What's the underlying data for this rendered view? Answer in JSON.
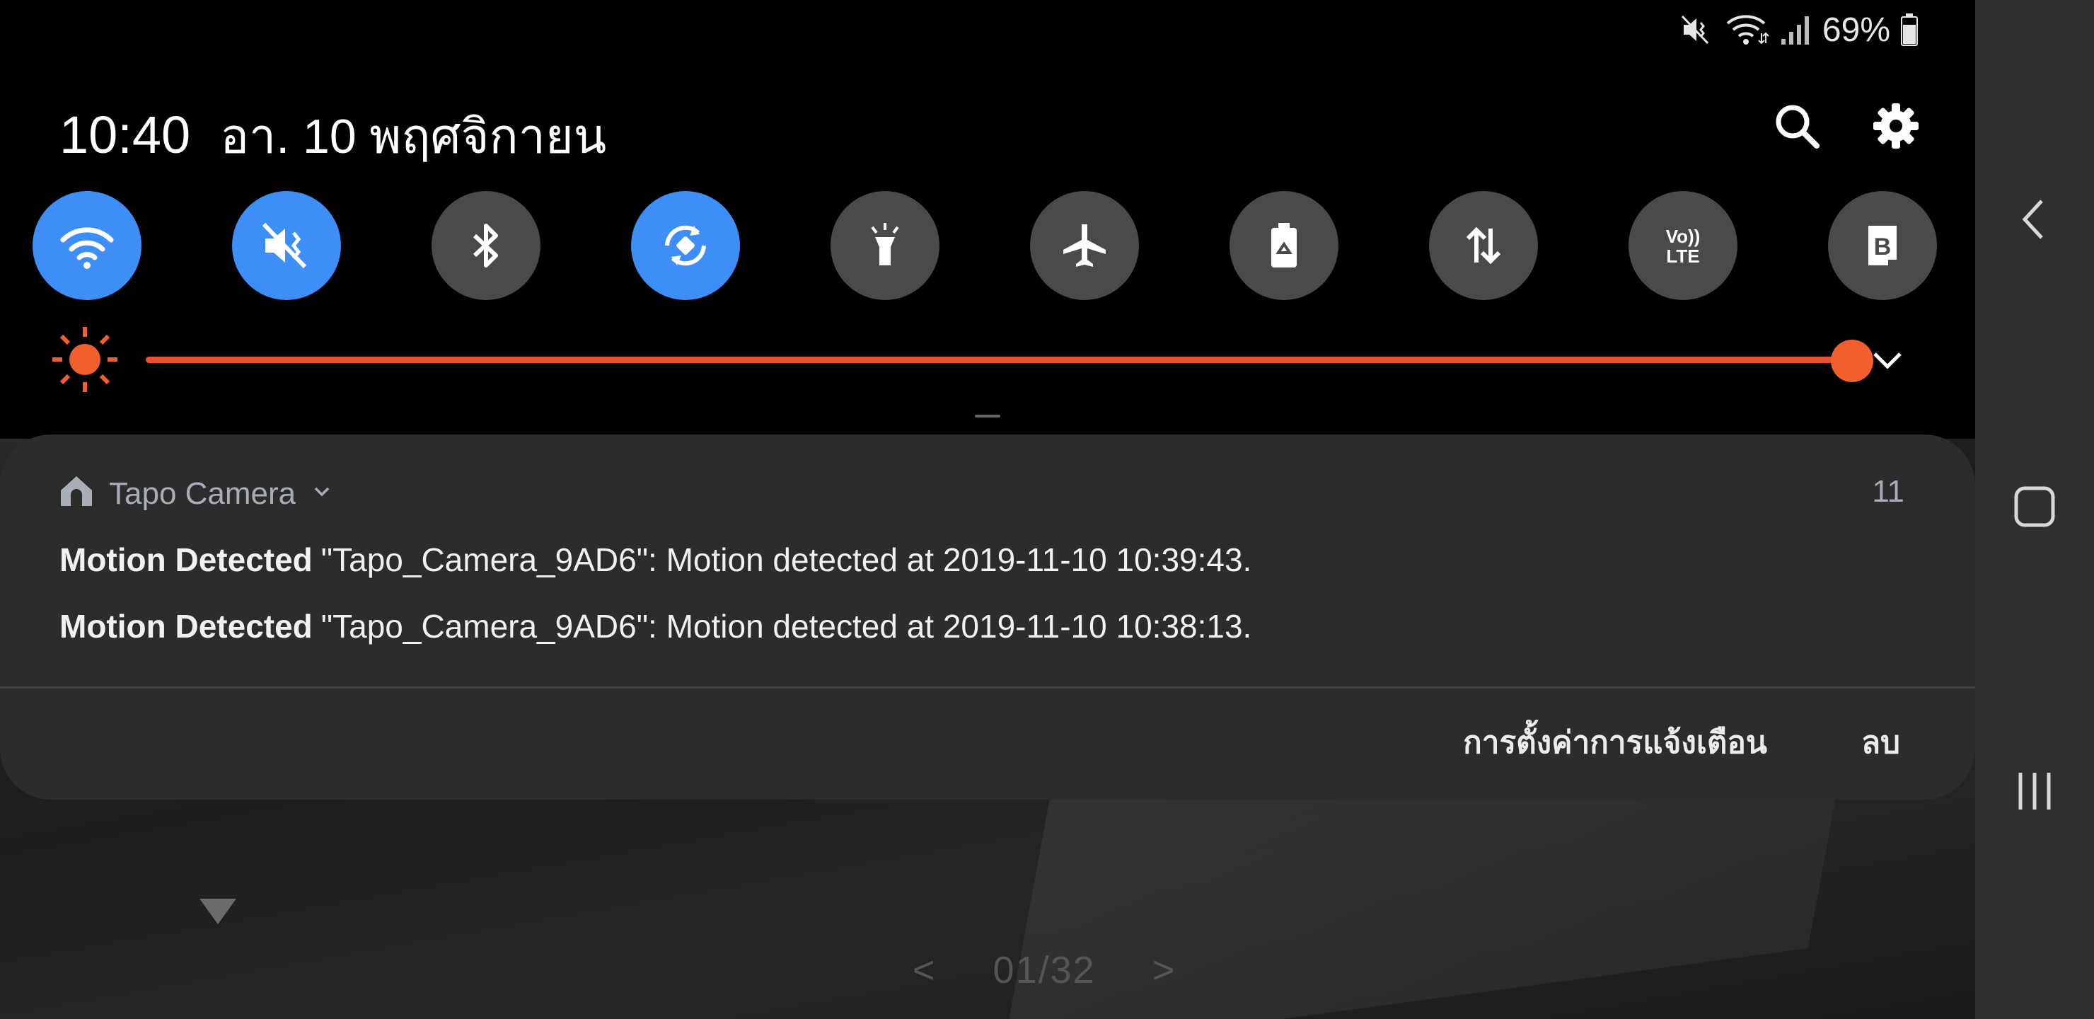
{
  "status_bar": {
    "battery_percent": "69%",
    "icons": [
      "mute-icon",
      "wifi-icon",
      "signal-icon",
      "battery-icon"
    ]
  },
  "header": {
    "time": "10:40",
    "date": "อา. 10 พฤศจิกายน",
    "icons": [
      "search-icon",
      "settings-gear-icon"
    ]
  },
  "quick_toggles": [
    {
      "name": "wifi",
      "on": true
    },
    {
      "name": "mute",
      "on": true
    },
    {
      "name": "bluetooth",
      "on": false
    },
    {
      "name": "auto-rotate",
      "on": true
    },
    {
      "name": "flashlight",
      "on": false
    },
    {
      "name": "airplane-mode",
      "on": false
    },
    {
      "name": "power-saving",
      "on": false
    },
    {
      "name": "mobile-data",
      "on": false
    },
    {
      "name": "volte",
      "on": false,
      "label_top": "Vo))",
      "label_bottom": "LTE"
    },
    {
      "name": "bixby-routines",
      "on": false,
      "label": "B"
    }
  ],
  "brightness": {
    "level": 1.0
  },
  "notification": {
    "app_name": "Tapo Camera",
    "count": "11",
    "items": [
      {
        "title": "Motion Detected",
        "text": "\"Tapo_Camera_9AD6\": Motion detected at 2019-11-10 10:39:43."
      },
      {
        "title": "Motion Detected",
        "text": "\"Tapo_Camera_9AD6\": Motion detected at 2019-11-10 10:38:13."
      }
    ],
    "actions": {
      "settings_label": "การตั้งค่าการแจ้งเตือน",
      "clear_label": "ลบ"
    }
  },
  "background": {
    "pager_prev": "<",
    "pager_text": "01/32",
    "pager_next": ">"
  },
  "colors": {
    "accent_toggle": "#3e8ef7",
    "brightness": "#e8532f",
    "card": "#2c2c2d"
  }
}
